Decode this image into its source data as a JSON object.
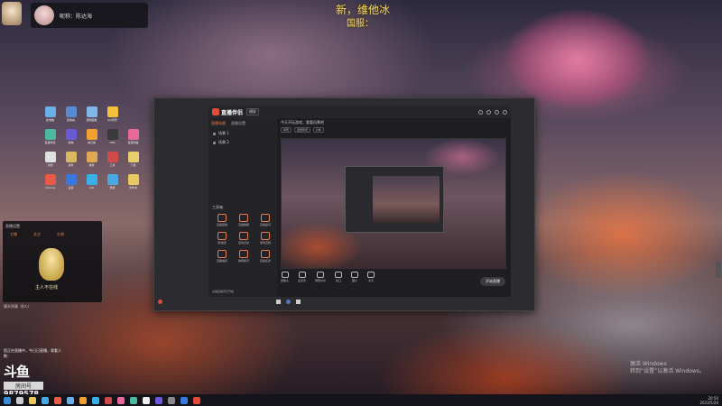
{
  "overlay": {
    "line1": "新，维他冰",
    "line2": "国服："
  },
  "user_chip": {
    "name": "昵称：陈达海"
  },
  "desktop_icons": [
    {
      "label": "此电脑",
      "color": "#6ab0e6"
    },
    {
      "label": "回收站",
      "color": "#5a8ad0"
    },
    {
      "label": "控制面板",
      "color": "#7fb8e8"
    },
    {
      "label": "QQ音乐",
      "color": "#f3c23c"
    },
    {
      "label": "",
      "color": "transparent"
    },
    {
      "label": "直播伴侣",
      "color": "#4cb8a0"
    },
    {
      "label": "剪映",
      "color": "#6a5ad8"
    },
    {
      "label": "向日葵",
      "color": "#f0a030"
    },
    {
      "label": "OBS",
      "color": "#3a3a3a"
    },
    {
      "label": "百度网盘",
      "color": "#e86a9a"
    },
    {
      "label": "文档",
      "color": "#e0e0e0"
    },
    {
      "label": "资料",
      "color": "#d8b860"
    },
    {
      "label": "素材",
      "color": "#e0a850"
    },
    {
      "label": "工具",
      "color": "#d04a4a"
    },
    {
      "label": "下载",
      "color": "#e8d070"
    },
    {
      "label": "Chrome",
      "color": "#e85a4a"
    },
    {
      "label": "设置",
      "color": "#3a78e0"
    },
    {
      "label": "QQ",
      "color": "#3ab0e8"
    },
    {
      "label": "录屏",
      "color": "#4aa8e0"
    },
    {
      "label": "文件夹",
      "color": "#e8c860"
    }
  ],
  "side_panel": {
    "header": "直播设置",
    "tabs": [
      "主播",
      "关注",
      "礼物"
    ],
    "caption": "主人不在线",
    "status": "观众列表（0人）"
  },
  "promo": {
    "note": "您正在直播中，今日已直播，观看人数：",
    "logo": "斗鱼",
    "badge": "房间号",
    "room_number": "9879578"
  },
  "app": {
    "brand": "直播伴侣",
    "mode_pill": "横屏",
    "left_tabs": [
      "直播场景",
      "直播设置"
    ],
    "scenes": [
      "场景 1",
      "场景 2"
    ],
    "tools_title": "工具箱",
    "tools": [
      "直播回放",
      "直播数据",
      "直播提词",
      "粉丝团",
      "连线互动",
      "游戏竞猜",
      "直播抽奖",
      "弹幕助手",
      "直播任务"
    ],
    "footer": "主播直播间已开启",
    "preview_head": "今天不玩游戏，看看风景吧",
    "preview_tags": [
      "风景",
      "自然风光",
      "户外"
    ],
    "controls": [
      "摄像头",
      "麦克风",
      "屏幕共享",
      "窗口",
      "图片",
      "文字"
    ],
    "start_label": "开始直播"
  },
  "watermark": {
    "line1": "激活 Windows",
    "line2": "转到“设置”以激活 Windows。"
  },
  "taskbar": {
    "time": "20:50",
    "date": "2023/5/20"
  }
}
